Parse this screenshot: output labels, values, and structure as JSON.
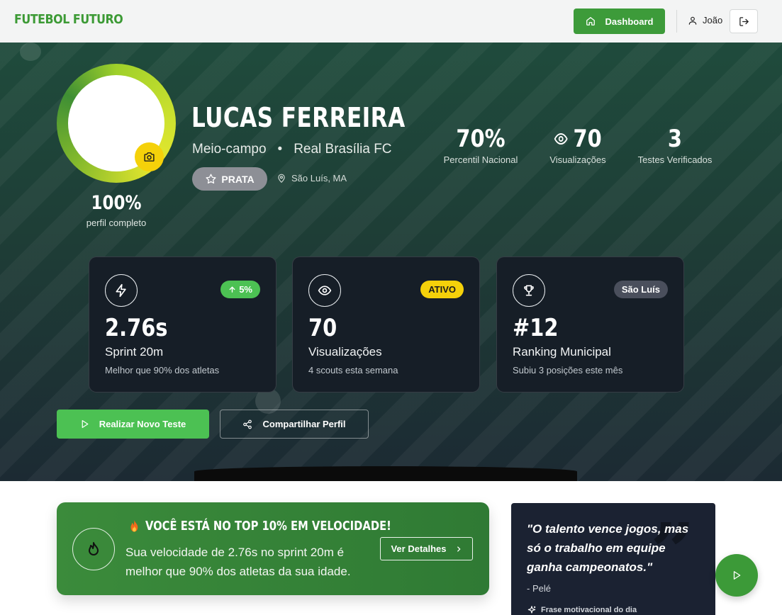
{
  "header": {
    "brand": "FUTEBOL FUTURO",
    "dashboard_label": "Dashboard",
    "user_name": "João"
  },
  "profile": {
    "name": "LUCAS FERREIRA",
    "position": "Meio-campo",
    "separator": "•",
    "club": "Real Brasília FC",
    "tier": "PRATA",
    "location": "São Luís, MA",
    "completion": "100%",
    "completion_label": "perfil completo",
    "completion_fraction": 1.0
  },
  "stats": [
    {
      "value": "70%",
      "label": "Percentil Nacional"
    },
    {
      "value": "70",
      "label": "Visualizações"
    },
    {
      "value": "3",
      "label": "Testes Verificados"
    }
  ],
  "cards": [
    {
      "icon": "bolt-icon",
      "badge": "5%",
      "badge_color": "#4cc153",
      "value": "2.76s",
      "title": "Sprint 20m",
      "subtitle": "Melhor que 90% dos atletas"
    },
    {
      "icon": "eye-icon",
      "badge": "ATIVO",
      "badge_color": "#f5d10a",
      "value": "70",
      "title": "Visualizações",
      "subtitle": "4 scouts esta semana"
    },
    {
      "icon": "trophy-icon",
      "badge": "São Luís",
      "badge_color": "#4a4f5c",
      "value": "#12",
      "title": "Ranking Municipal",
      "subtitle": "Subiu 3 posições este mês"
    }
  ],
  "actions": {
    "primary": "Realizar Novo Teste",
    "secondary": "Compartilhar Perfil"
  },
  "achievement": {
    "title": "VOCÊ ESTÁ NO TOP 10% EM VELOCIDADE!",
    "text": "Sua velocidade de 2.76s no sprint 20m é melhor que 90% dos atletas da sua idade.",
    "button": "Ver Detalhes"
  },
  "quote": {
    "text": "\"O talento vence jogos, mas só o trabalho em equipe ganha campeonatos.\"",
    "author": "- Pelé",
    "footer": "Frase motivacional do dia"
  },
  "colors": {
    "brand": "#3c9a35",
    "primary_green": "#4cc153",
    "accent_yellow": "#f5d10a",
    "tier_silver": "#8d8f96"
  }
}
